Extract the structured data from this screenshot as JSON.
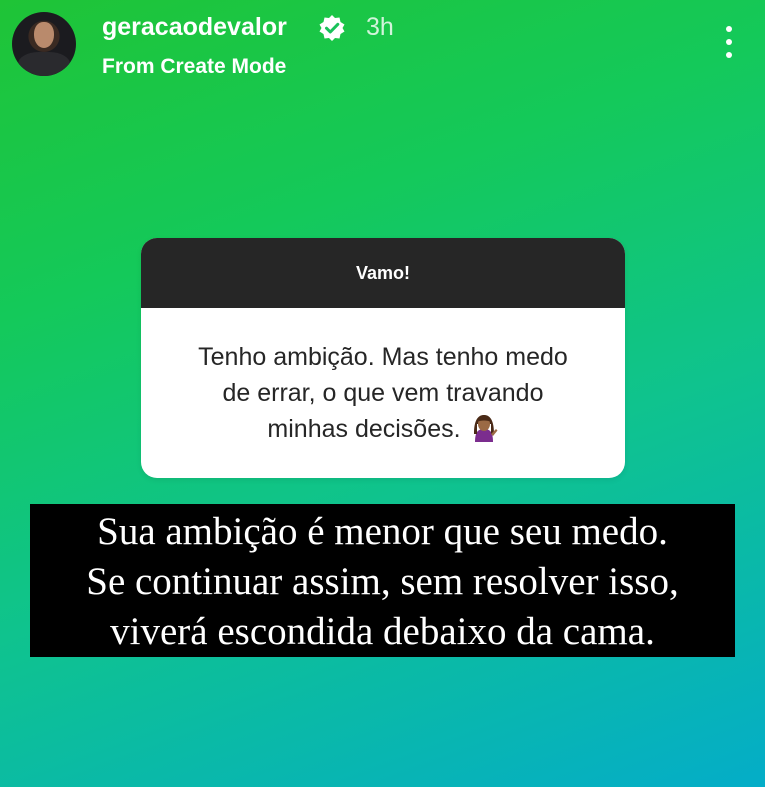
{
  "header": {
    "username": "geracaodevalor",
    "verified_icon": "verified-badge-icon",
    "time": "3h",
    "subtitle": "From Create Mode",
    "menu_icon": "more-vertical-icon"
  },
  "question_box": {
    "title": "Vamo!",
    "text": "Tenho ambição. Mas tenho medo\nde errar,  o que vem travando\nminhas decisões.",
    "emoji_icon": "woman-tipping-hand-emoji"
  },
  "caption": {
    "text": "Sua ambição é menor que seu medo.\nSe continuar assim, sem resolver isso,\nviverá escondida debaixo da cama."
  },
  "colors": {
    "background_top": "#1fc436",
    "background_bottom": "#04adc8",
    "question_header": "#262626",
    "caption_bg": "#000000"
  }
}
